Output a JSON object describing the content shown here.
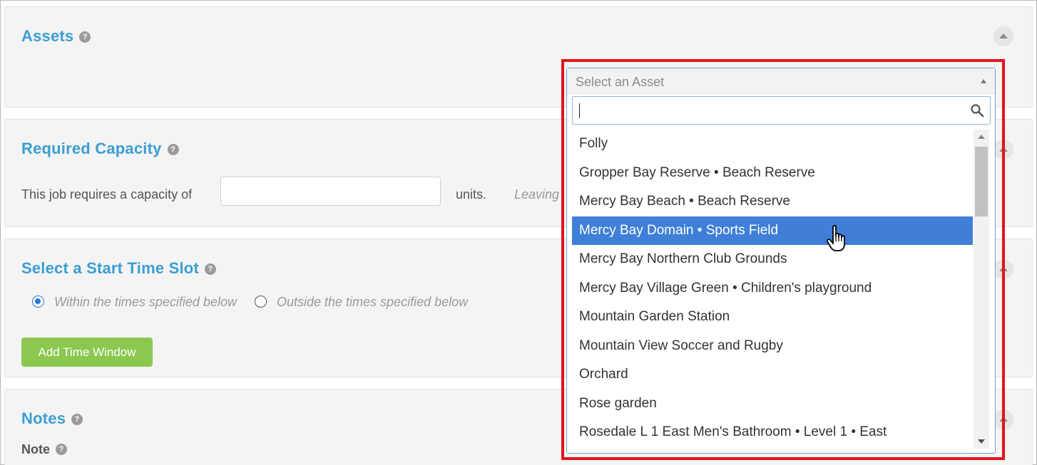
{
  "assets": {
    "title": "Assets",
    "help": "?"
  },
  "capacity": {
    "title": "Required Capacity",
    "help": "?",
    "label": "This job requires a capacity of",
    "value": "",
    "units": "units.",
    "hint": "Leaving"
  },
  "timeslot": {
    "title": "Select a Start Time Slot",
    "help": "?",
    "option_within": "Within the times specified below",
    "option_outside": "Outside the times specified below",
    "selected": "within",
    "add_button": "Add Time Window"
  },
  "notes": {
    "title": "Notes",
    "help": "?",
    "note_label": "Note",
    "note_help": "?"
  },
  "asset_select": {
    "placeholder": "Select an Asset",
    "search_value": "",
    "highlighted_index": 3,
    "options": [
      "Folly",
      "Gropper Bay Reserve • Beach Reserve",
      "Mercy Bay Beach • Beach Reserve",
      "Mercy Bay Domain • Sports Field",
      "Mercy Bay Northern Club Grounds",
      "Mercy Bay Village Green • Children's playground",
      "Mountain Garden Station",
      "Mountain View Soccer and Rugby",
      "Orchard",
      "Rose garden",
      "Rosedale L 1 East Men's Bathroom • Level 1 • East"
    ]
  },
  "colors": {
    "title_blue": "#3b9ed3",
    "highlight_red": "#e0141e",
    "option_highlight": "#3f7fd8",
    "button_green": "#8cc850"
  }
}
